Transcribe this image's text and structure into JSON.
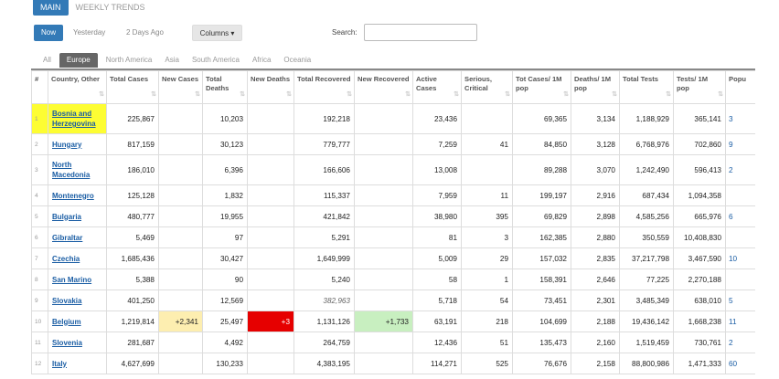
{
  "tabs": [
    {
      "label": "MAIN",
      "active": true
    },
    {
      "label": "WEEKLY TRENDS",
      "active": false
    }
  ],
  "day_buttons": {
    "now": "Now",
    "yesterday": "Yesterday",
    "two_days": "2 Days Ago"
  },
  "columns_button": "Columns ▾",
  "search": {
    "label": "Search:",
    "value": ""
  },
  "regions": [
    {
      "label": "All",
      "active": false
    },
    {
      "label": "Europe",
      "active": true
    },
    {
      "label": "North America",
      "active": false
    },
    {
      "label": "Asia",
      "active": false
    },
    {
      "label": "South America",
      "active": false
    },
    {
      "label": "Africa",
      "active": false
    },
    {
      "label": "Oceania",
      "active": false
    }
  ],
  "headers": [
    "#",
    "Country, Other",
    "Total Cases",
    "New Cases",
    "Total Deaths",
    "New Deaths",
    "Total Recovered",
    "New Recovered",
    "Active Cases",
    "Serious, Critical",
    "Tot Cases/ 1M pop",
    "Deaths/ 1M pop",
    "Total Tests",
    "Tests/ 1M pop",
    "Popu"
  ],
  "rows": [
    {
      "rank": "1",
      "country": "Bosnia and Herzegovina",
      "total_cases": "225,867",
      "new_cases": "",
      "total_deaths": "10,203",
      "new_deaths": "",
      "total_recovered": "192,218",
      "new_recovered": "",
      "active": "23,436",
      "serious": "",
      "cases_1m": "69,365",
      "deaths_1m": "3,134",
      "total_tests": "1,188,929",
      "tests_1m": "365,141",
      "pop": "3"
    },
    {
      "rank": "2",
      "country": "Hungary",
      "total_cases": "817,159",
      "new_cases": "",
      "total_deaths": "30,123",
      "new_deaths": "",
      "total_recovered": "779,777",
      "new_recovered": "",
      "active": "7,259",
      "serious": "41",
      "cases_1m": "84,850",
      "deaths_1m": "3,128",
      "total_tests": "6,768,976",
      "tests_1m": "702,860",
      "pop": "9"
    },
    {
      "rank": "3",
      "country": "North Macedonia",
      "total_cases": "186,010",
      "new_cases": "",
      "total_deaths": "6,396",
      "new_deaths": "",
      "total_recovered": "166,606",
      "new_recovered": "",
      "active": "13,008",
      "serious": "",
      "cases_1m": "89,288",
      "deaths_1m": "3,070",
      "total_tests": "1,242,490",
      "tests_1m": "596,413",
      "pop": "2"
    },
    {
      "rank": "4",
      "country": "Montenegro",
      "total_cases": "125,128",
      "new_cases": "",
      "total_deaths": "1,832",
      "new_deaths": "",
      "total_recovered": "115,337",
      "new_recovered": "",
      "active": "7,959",
      "serious": "11",
      "cases_1m": "199,197",
      "deaths_1m": "2,916",
      "total_tests": "687,434",
      "tests_1m": "1,094,358",
      "pop": ""
    },
    {
      "rank": "5",
      "country": "Bulgaria",
      "total_cases": "480,777",
      "new_cases": "",
      "total_deaths": "19,955",
      "new_deaths": "",
      "total_recovered": "421,842",
      "new_recovered": "",
      "active": "38,980",
      "serious": "395",
      "cases_1m": "69,829",
      "deaths_1m": "2,898",
      "total_tests": "4,585,256",
      "tests_1m": "665,976",
      "pop": "6"
    },
    {
      "rank": "6",
      "country": "Gibraltar",
      "total_cases": "5,469",
      "new_cases": "",
      "total_deaths": "97",
      "new_deaths": "",
      "total_recovered": "5,291",
      "new_recovered": "",
      "active": "81",
      "serious": "3",
      "cases_1m": "162,385",
      "deaths_1m": "2,880",
      "total_tests": "350,559",
      "tests_1m": "10,408,830",
      "pop": ""
    },
    {
      "rank": "7",
      "country": "Czechia",
      "total_cases": "1,685,436",
      "new_cases": "",
      "total_deaths": "30,427",
      "new_deaths": "",
      "total_recovered": "1,649,999",
      "new_recovered": "",
      "active": "5,009",
      "serious": "29",
      "cases_1m": "157,032",
      "deaths_1m": "2,835",
      "total_tests": "37,217,798",
      "tests_1m": "3,467,590",
      "pop": "10"
    },
    {
      "rank": "8",
      "country": "San Marino",
      "total_cases": "5,388",
      "new_cases": "",
      "total_deaths": "90",
      "new_deaths": "",
      "total_recovered": "5,240",
      "new_recovered": "",
      "active": "58",
      "serious": "1",
      "cases_1m": "158,391",
      "deaths_1m": "2,646",
      "total_tests": "77,225",
      "tests_1m": "2,270,188",
      "pop": ""
    },
    {
      "rank": "9",
      "country": "Slovakia",
      "total_cases": "401,250",
      "new_cases": "",
      "total_deaths": "12,569",
      "new_deaths": "",
      "total_recovered": "382,963",
      "new_recovered": "",
      "active": "5,718",
      "serious": "54",
      "cases_1m": "73,451",
      "deaths_1m": "2,301",
      "total_tests": "3,485,349",
      "tests_1m": "638,010",
      "pop": "5"
    },
    {
      "rank": "10",
      "country": "Belgium",
      "total_cases": "1,219,814",
      "new_cases": "+2,341",
      "total_deaths": "25,497",
      "new_deaths": "+3",
      "total_recovered": "1,131,126",
      "new_recovered": "+1,733",
      "active": "63,191",
      "serious": "218",
      "cases_1m": "104,699",
      "deaths_1m": "2,188",
      "total_tests": "19,436,142",
      "tests_1m": "1,668,238",
      "pop": "11"
    },
    {
      "rank": "11",
      "country": "Slovenia",
      "total_cases": "281,687",
      "new_cases": "",
      "total_deaths": "4,492",
      "new_deaths": "",
      "total_recovered": "264,759",
      "new_recovered": "",
      "active": "12,436",
      "serious": "51",
      "cases_1m": "135,473",
      "deaths_1m": "2,160",
      "total_tests": "1,519,459",
      "tests_1m": "730,761",
      "pop": "2"
    },
    {
      "rank": "12",
      "country": "Italy",
      "total_cases": "4,627,699",
      "new_cases": "",
      "total_deaths": "130,233",
      "new_deaths": "",
      "total_recovered": "4,383,195",
      "new_recovered": "",
      "active": "114,271",
      "serious": "525",
      "cases_1m": "76,676",
      "deaths_1m": "2,158",
      "total_tests": "88,800,986",
      "tests_1m": "1,471,333",
      "pop": "60"
    }
  ]
}
